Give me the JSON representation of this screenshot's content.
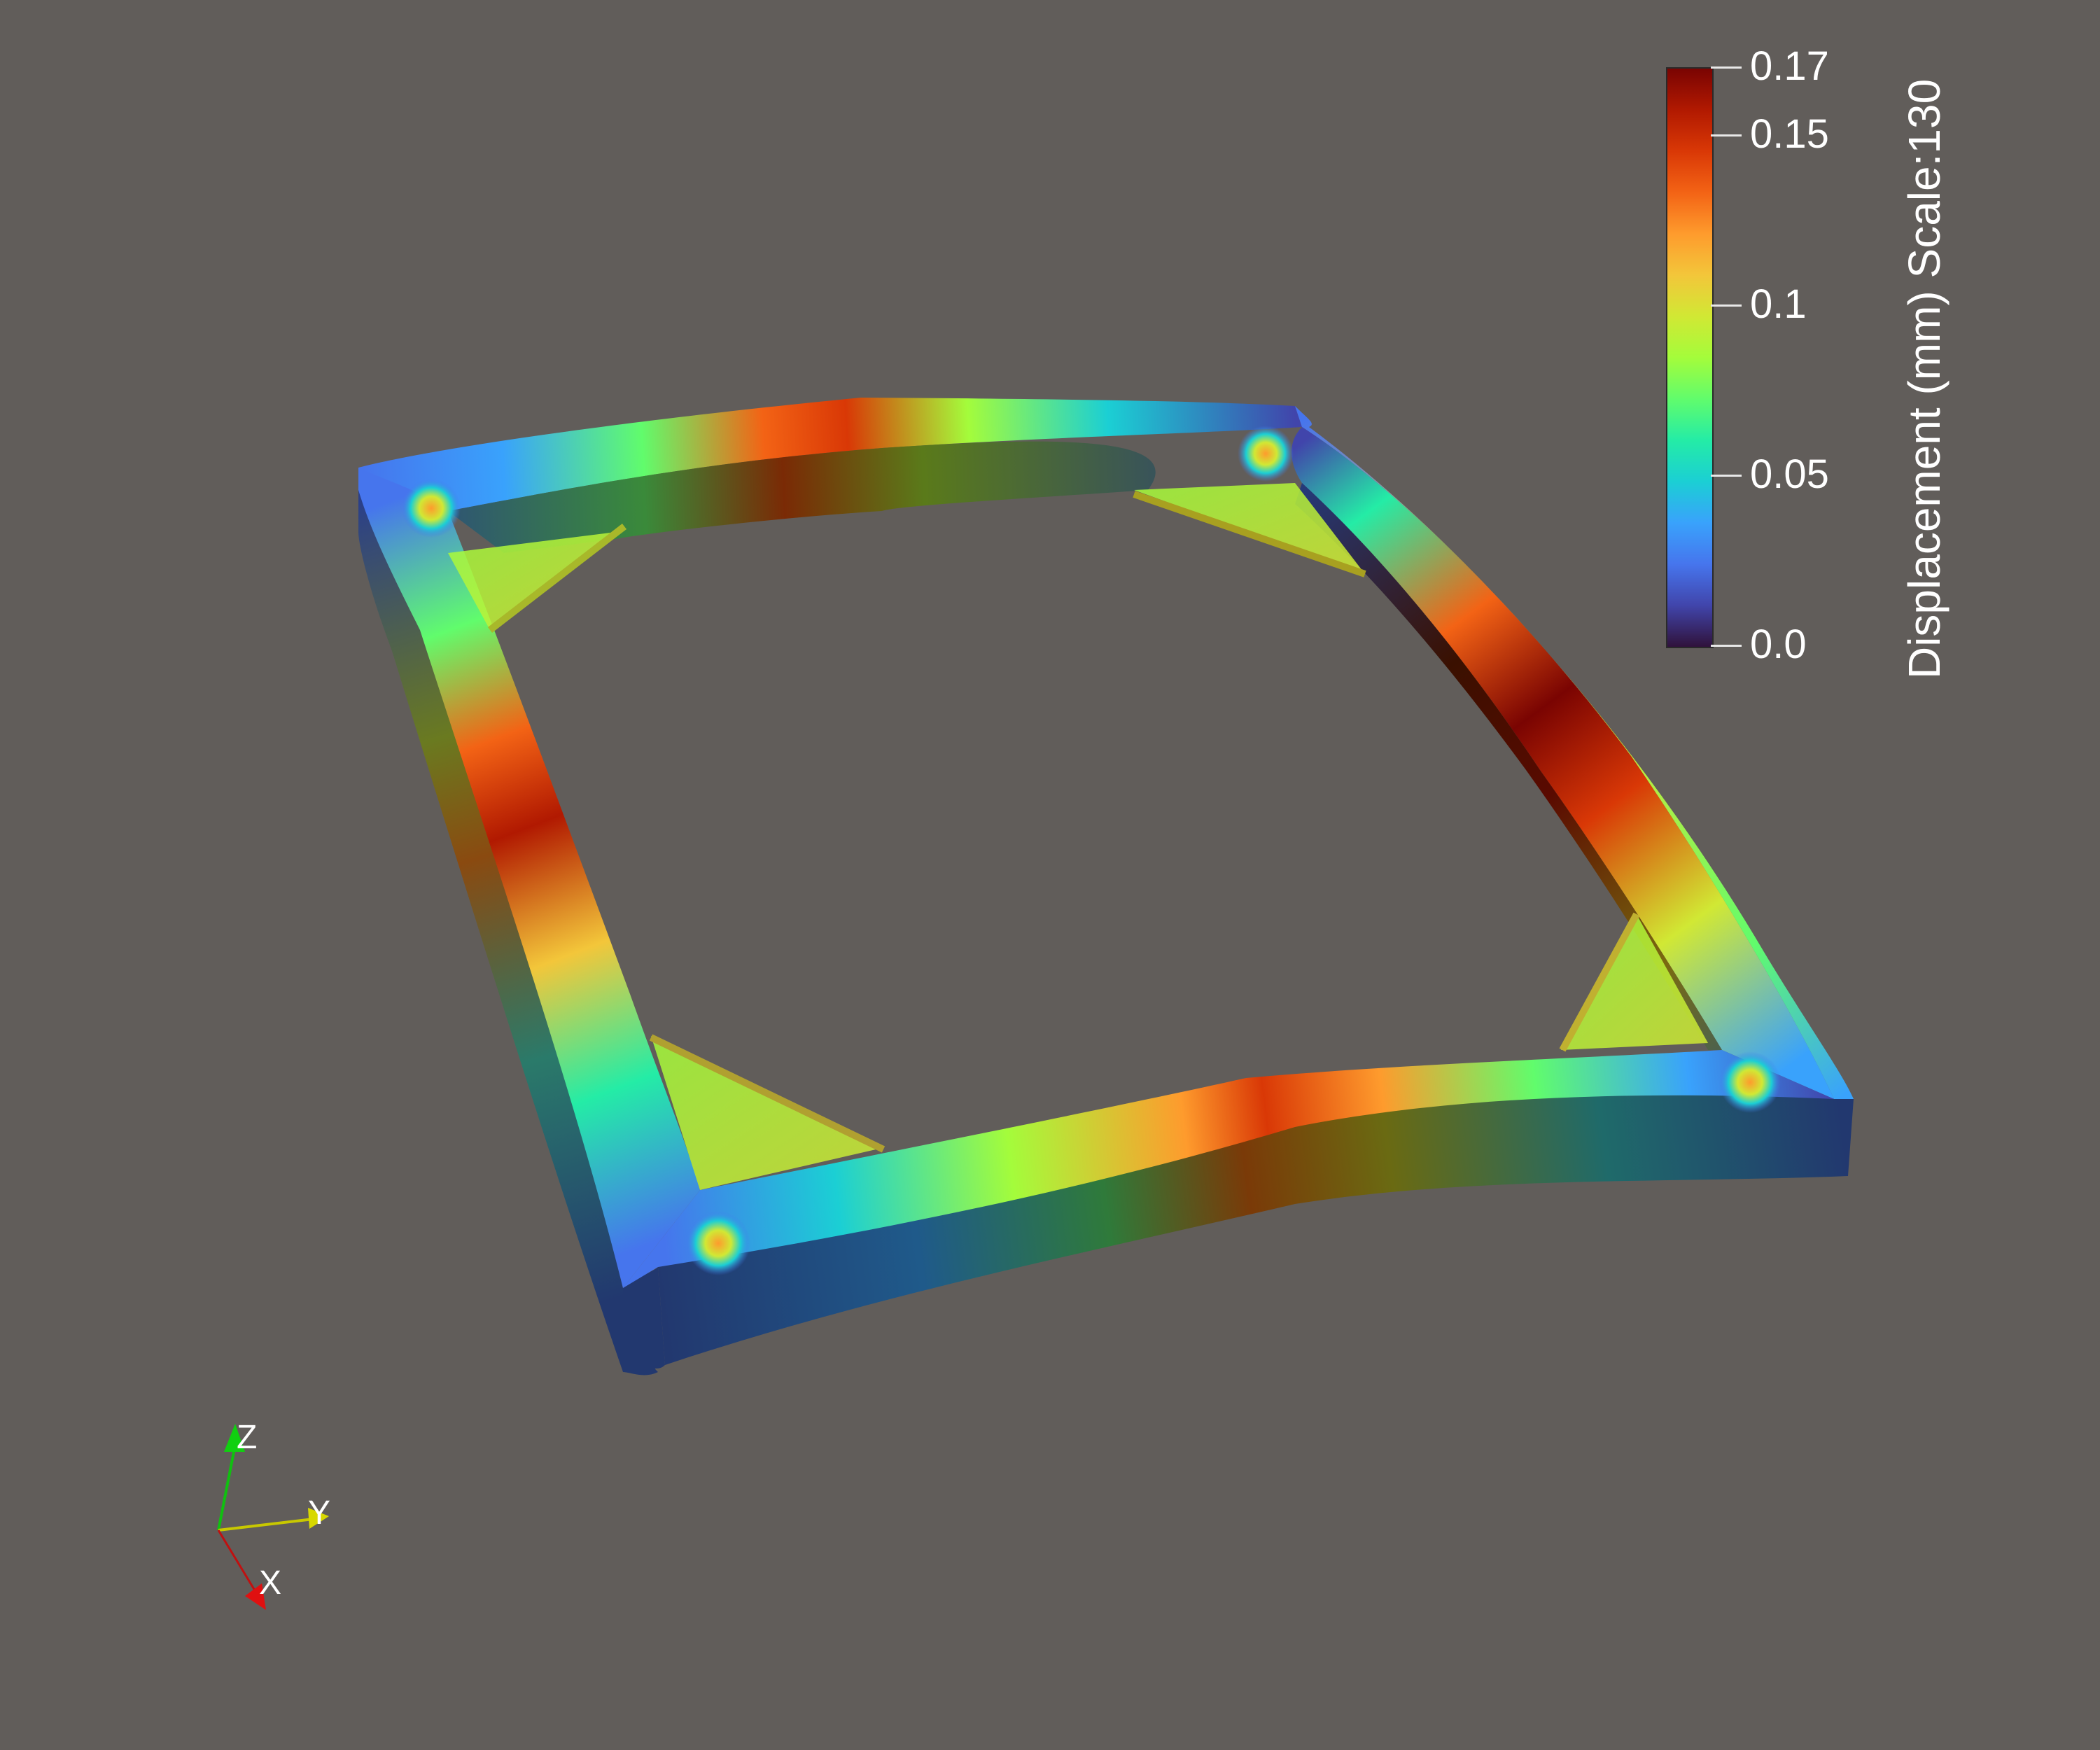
{
  "viewer": {
    "background_color": "#615d5a"
  },
  "colorbar": {
    "title": "Displacement (mm) Scale:130",
    "min": 0.0,
    "max": 0.17,
    "ticks": [
      {
        "label": "0.17",
        "value": 0.17
      },
      {
        "label": "0.15",
        "value": 0.15
      },
      {
        "label": "0.1",
        "value": 0.1
      },
      {
        "label": "0.05",
        "value": 0.05
      },
      {
        "label": "0.0",
        "value": 0.0
      }
    ],
    "colormap": [
      "#30123b",
      "#4145ab",
      "#4675ed",
      "#39a2fc",
      "#1bcfd4",
      "#24eca6",
      "#61fc6c",
      "#a4fc3b",
      "#d1e834",
      "#f3c63a",
      "#fe9b2d",
      "#f36315",
      "#d93806",
      "#b11901",
      "#7a0402"
    ]
  },
  "orientation_axes": {
    "x": {
      "label": "X",
      "color": "#e01010"
    },
    "y": {
      "label": "Y",
      "color": "#d8d800"
    },
    "z": {
      "label": "Z",
      "color": "#10d010"
    }
  }
}
